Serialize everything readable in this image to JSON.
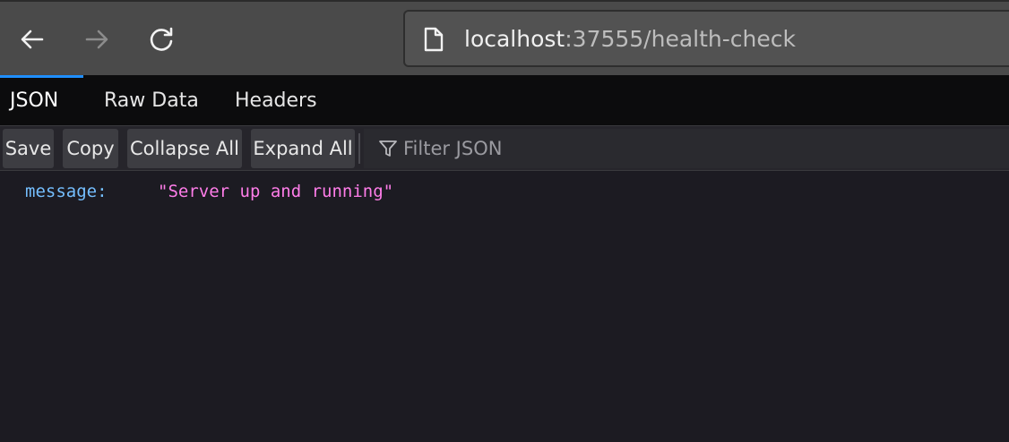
{
  "browser": {
    "url_host": "localhost",
    "url_rest": ":37555/health-check",
    "icons": {
      "back": "arrow-left-icon",
      "forward": "arrow-right-icon",
      "reload": "reload-icon",
      "page": "page-icon"
    }
  },
  "viewer": {
    "tabs": [
      {
        "label": "JSON",
        "active": true
      },
      {
        "label": "Raw Data",
        "active": false
      },
      {
        "label": "Headers",
        "active": false
      }
    ],
    "toolbar": {
      "save_label": "Save",
      "copy_label": "Copy",
      "collapse_label": "Collapse All",
      "expand_label": "Expand All",
      "filter_placeholder": "Filter JSON",
      "filter_value": ""
    },
    "rows": [
      {
        "key": "message:",
        "value": "\"Server up and running\""
      }
    ],
    "colors": {
      "accent": "#1f8fff",
      "key": "#75bfff",
      "string": "#ff7de9"
    }
  }
}
